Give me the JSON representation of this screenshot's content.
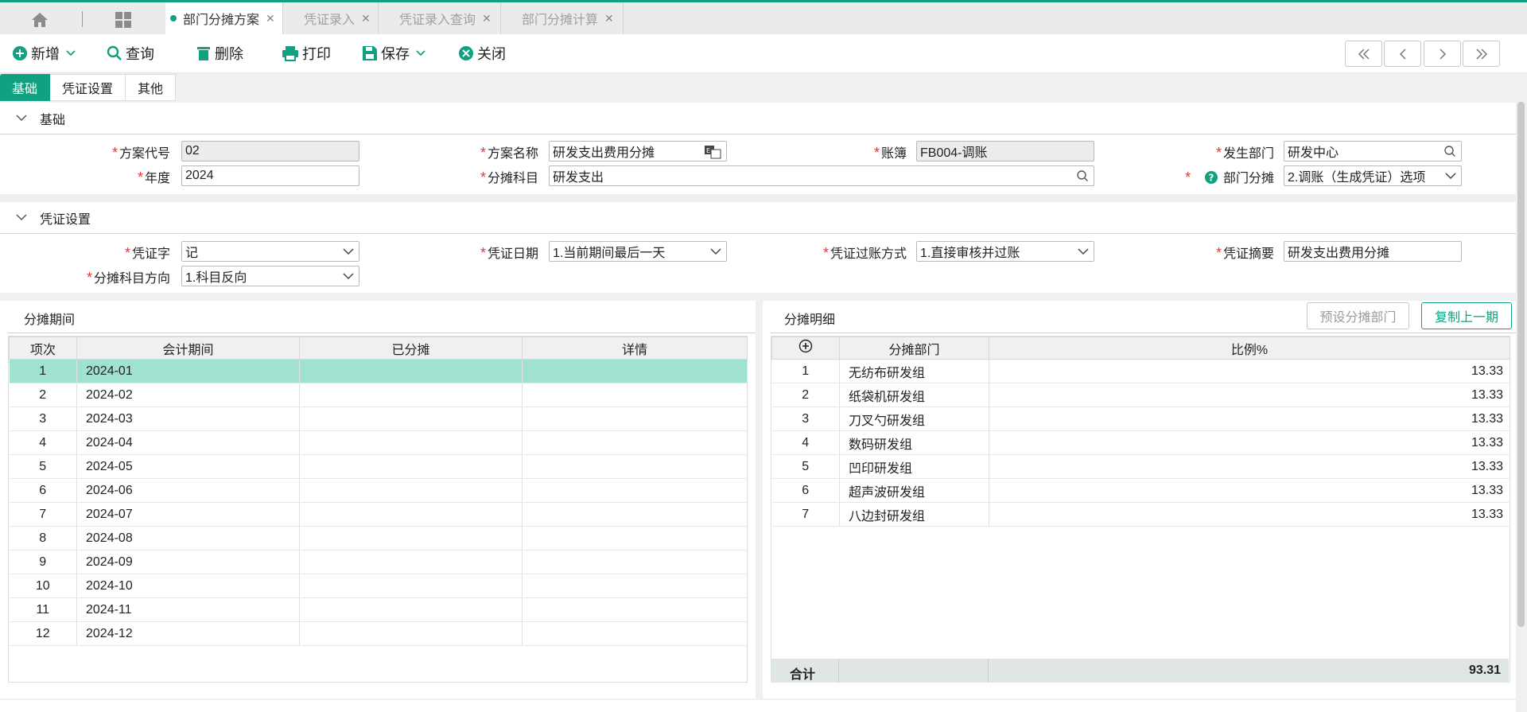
{
  "tabs": [
    {
      "label": "部门分摊方案",
      "active": true
    },
    {
      "label": "凭证录入",
      "active": false
    },
    {
      "label": "凭证录入查询",
      "active": false
    },
    {
      "label": "部门分摊计算",
      "active": false
    }
  ],
  "toolbar": {
    "new_label": "新增",
    "query_label": "查询",
    "delete_label": "删除",
    "print_label": "打印",
    "save_label": "保存",
    "close_label": "关闭"
  },
  "subtabs": [
    "基础",
    "凭证设置",
    "其他"
  ],
  "basic": {
    "section_title": "基础",
    "plan_code_label": "方案代号",
    "plan_code": "02",
    "plan_name_label": "方案名称",
    "plan_name": "研发支出费用分摊",
    "ledger_label": "账簿",
    "ledger": "FB004-调账",
    "dept_label": "发生部门",
    "dept": "研发中心",
    "year_label": "年度",
    "year": "2024",
    "subject_label": "分摊科目",
    "subject": "研发支出",
    "dept_alloc_label": "部门分摊",
    "dept_alloc": "2.调账（生成凭证）选项"
  },
  "voucher": {
    "section_title": "凭证设置",
    "word_label": "凭证字",
    "word": "记",
    "date_label": "凭证日期",
    "date": "1.当前期间最后一天",
    "post_label": "凭证过账方式",
    "post": "1.直接审核并过账",
    "summary_label": "凭证摘要",
    "summary": "研发支出费用分摊",
    "direction_label": "分摊科目方向",
    "direction": "1.科目反向"
  },
  "periods": {
    "title": "分摊期间",
    "headers": [
      "项次",
      "会计期间",
      "已分摊",
      "详情"
    ],
    "rows": [
      {
        "no": "1",
        "period": "2024-01"
      },
      {
        "no": "2",
        "period": "2024-02"
      },
      {
        "no": "3",
        "period": "2024-03"
      },
      {
        "no": "4",
        "period": "2024-04"
      },
      {
        "no": "5",
        "period": "2024-05"
      },
      {
        "no": "6",
        "period": "2024-06"
      },
      {
        "no": "7",
        "period": "2024-07"
      },
      {
        "no": "8",
        "period": "2024-08"
      },
      {
        "no": "9",
        "period": "2024-09"
      },
      {
        "no": "10",
        "period": "2024-10"
      },
      {
        "no": "11",
        "period": "2024-11"
      },
      {
        "no": "12",
        "period": "2024-12"
      }
    ]
  },
  "details": {
    "title": "分摊明细",
    "preset_label": "预设分摊部门",
    "copy_label": "复制上一期",
    "headers": [
      "分摊部门",
      "比例%"
    ],
    "rows": [
      {
        "no": "1",
        "dept": "无纺布研发组",
        "ratio": "13.33"
      },
      {
        "no": "2",
        "dept": "纸袋机研发组",
        "ratio": "13.33"
      },
      {
        "no": "3",
        "dept": "刀叉勺研发组",
        "ratio": "13.33"
      },
      {
        "no": "4",
        "dept": "数码研发组",
        "ratio": "13.33"
      },
      {
        "no": "5",
        "dept": "凹印研发组",
        "ratio": "13.33"
      },
      {
        "no": "6",
        "dept": "超声波研发组",
        "ratio": "13.33"
      },
      {
        "no": "7",
        "dept": "八边封研发组",
        "ratio": "13.33"
      }
    ],
    "total_label": "合计",
    "total": "93.31"
  }
}
